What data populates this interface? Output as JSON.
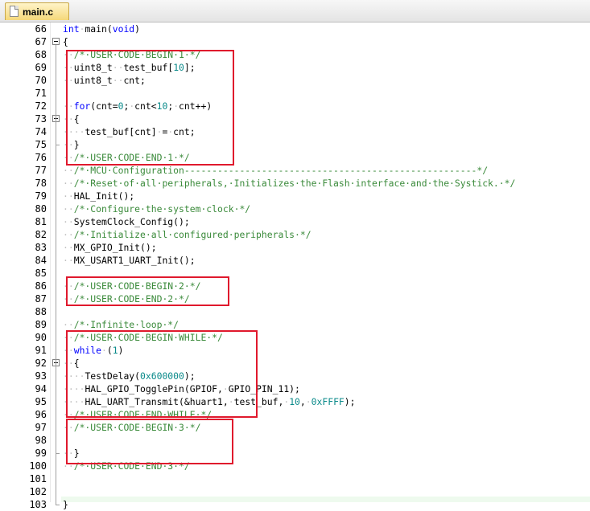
{
  "tab": {
    "label": "main.c",
    "icon": "file-icon"
  },
  "colors": {
    "comment": "#3a8a3a",
    "keyword": "#0000ff",
    "number": "#0a8a8a",
    "highlight": "#e0192d"
  },
  "lines": [
    {
      "num": "66",
      "segs": [
        [
          "kw",
          "int"
        ],
        [
          "ws",
          "·"
        ],
        [
          "",
          "main("
        ],
        [
          "kw",
          "void"
        ],
        [
          "",
          ")"
        ]
      ]
    },
    {
      "num": "67",
      "segs": [
        [
          "",
          "{"
        ]
      ]
    },
    {
      "num": "68",
      "segs": [
        [
          "ws",
          "··"
        ],
        [
          "cm",
          "/*·USER·CODE·BEGIN·1·*/"
        ]
      ]
    },
    {
      "num": "69",
      "segs": [
        [
          "ws",
          "··"
        ],
        [
          "",
          "uint8_t"
        ],
        [
          "ws",
          "··"
        ],
        [
          "",
          "test_buf["
        ],
        [
          "nm",
          "10"
        ],
        [
          "",
          "];"
        ]
      ]
    },
    {
      "num": "70",
      "segs": [
        [
          "ws",
          "··"
        ],
        [
          "",
          "uint8_t"
        ],
        [
          "ws",
          "··"
        ],
        [
          "",
          "cnt;"
        ]
      ]
    },
    {
      "num": "71",
      "segs": []
    },
    {
      "num": "72",
      "segs": [
        [
          "ws",
          "··"
        ],
        [
          "kw",
          "for"
        ],
        [
          "",
          "(cnt="
        ],
        [
          "nm",
          "0"
        ],
        [
          "",
          ";"
        ],
        [
          "ws",
          "·"
        ],
        [
          "",
          "cnt<"
        ],
        [
          "nm",
          "10"
        ],
        [
          "",
          ";"
        ],
        [
          "ws",
          "·"
        ],
        [
          "",
          "cnt++)"
        ]
      ]
    },
    {
      "num": "73",
      "segs": [
        [
          "ws",
          "··"
        ],
        [
          "",
          "{"
        ]
      ]
    },
    {
      "num": "74",
      "segs": [
        [
          "ws",
          "····"
        ],
        [
          "",
          "test_buf[cnt]"
        ],
        [
          "ws",
          "·"
        ],
        [
          "",
          "="
        ],
        [
          "ws",
          "·"
        ],
        [
          "",
          "cnt;"
        ]
      ]
    },
    {
      "num": "75",
      "segs": [
        [
          "ws",
          "··"
        ],
        [
          "",
          "}"
        ]
      ]
    },
    {
      "num": "76",
      "segs": [
        [
          "ws",
          "··"
        ],
        [
          "cm",
          "/*·USER·CODE·END·1·*/"
        ]
      ]
    },
    {
      "num": "77",
      "segs": [
        [
          "ws",
          "··"
        ],
        [
          "cm",
          "/*·MCU·Configuration-----------------------------------------------------*/"
        ]
      ]
    },
    {
      "num": "78",
      "segs": [
        [
          "ws",
          "··"
        ],
        [
          "cm",
          "/*·Reset·of·all·peripherals,·Initializes·the·Flash·interface·and·the·Systick.·*/"
        ]
      ]
    },
    {
      "num": "79",
      "segs": [
        [
          "ws",
          "··"
        ],
        [
          "",
          "HAL_Init();"
        ]
      ]
    },
    {
      "num": "80",
      "segs": [
        [
          "ws",
          "··"
        ],
        [
          "cm",
          "/*·Configure·the·system·clock·*/"
        ]
      ]
    },
    {
      "num": "81",
      "segs": [
        [
          "ws",
          "··"
        ],
        [
          "",
          "SystemClock_Config();"
        ]
      ]
    },
    {
      "num": "82",
      "segs": [
        [
          "ws",
          "··"
        ],
        [
          "cm",
          "/*·Initialize·all·configured·peripherals·*/"
        ]
      ]
    },
    {
      "num": "83",
      "segs": [
        [
          "ws",
          "··"
        ],
        [
          "",
          "MX_GPIO_Init();"
        ]
      ]
    },
    {
      "num": "84",
      "segs": [
        [
          "ws",
          "··"
        ],
        [
          "",
          "MX_USART1_UART_Init();"
        ]
      ]
    },
    {
      "num": "85",
      "segs": []
    },
    {
      "num": "86",
      "segs": [
        [
          "ws",
          "··"
        ],
        [
          "cm",
          "/*·USER·CODE·BEGIN·2·*/"
        ]
      ]
    },
    {
      "num": "87",
      "segs": [
        [
          "ws",
          "··"
        ],
        [
          "cm",
          "/*·USER·CODE·END·2·*/"
        ]
      ]
    },
    {
      "num": "88",
      "segs": []
    },
    {
      "num": "89",
      "segs": [
        [
          "ws",
          "··"
        ],
        [
          "cm",
          "/*·Infinite·loop·*/"
        ]
      ]
    },
    {
      "num": "90",
      "segs": [
        [
          "ws",
          "··"
        ],
        [
          "cm",
          "/*·USER·CODE·BEGIN·WHILE·*/"
        ]
      ]
    },
    {
      "num": "91",
      "segs": [
        [
          "ws",
          "··"
        ],
        [
          "kw",
          "while"
        ],
        [
          "ws",
          "·"
        ],
        [
          "",
          "("
        ],
        [
          "nm",
          "1"
        ],
        [
          "",
          ")"
        ]
      ]
    },
    {
      "num": "92",
      "segs": [
        [
          "ws",
          "··"
        ],
        [
          "",
          "{"
        ]
      ]
    },
    {
      "num": "93",
      "segs": [
        [
          "ws",
          "····"
        ],
        [
          "",
          "TestDelay("
        ],
        [
          "nm",
          "0x600000"
        ],
        [
          "",
          ");"
        ]
      ]
    },
    {
      "num": "94",
      "segs": [
        [
          "ws",
          "····"
        ],
        [
          "",
          "HAL_GPIO_TogglePin(GPIOF,"
        ],
        [
          "ws",
          "·"
        ],
        [
          "",
          "GPIO_PIN_11);"
        ]
      ]
    },
    {
      "num": "95",
      "segs": [
        [
          "ws",
          "····"
        ],
        [
          "",
          "HAL_UART_Transmit(&huart1,"
        ],
        [
          "ws",
          "·"
        ],
        [
          "",
          "test_buf,"
        ],
        [
          "ws",
          "·"
        ],
        [
          "nm",
          "10"
        ],
        [
          "",
          ","
        ],
        [
          "ws",
          "·"
        ],
        [
          "nm",
          "0xFFFF"
        ],
        [
          "",
          ");"
        ]
      ]
    },
    {
      "num": "96",
      "segs": [
        [
          "ws",
          "··"
        ],
        [
          "cm",
          "/*·USER·CODE·END·WHILE·*/"
        ]
      ]
    },
    {
      "num": "97",
      "segs": [
        [
          "ws",
          "··"
        ],
        [
          "cm",
          "/*·USER·CODE·BEGIN·3·*/"
        ]
      ]
    },
    {
      "num": "98",
      "segs": []
    },
    {
      "num": "99",
      "segs": [
        [
          "ws",
          "··"
        ],
        [
          "",
          "}"
        ]
      ]
    },
    {
      "num": "100",
      "segs": [
        [
          "ws",
          "··"
        ],
        [
          "cm",
          "/*·USER·CODE·END·3·*/"
        ]
      ]
    },
    {
      "num": "101",
      "segs": []
    },
    {
      "num": "102",
      "segs": []
    },
    {
      "num": "103",
      "segs": [
        [
          "",
          "}"
        ]
      ]
    }
  ],
  "fold_markers": [
    "67",
    "73",
    "92"
  ]
}
